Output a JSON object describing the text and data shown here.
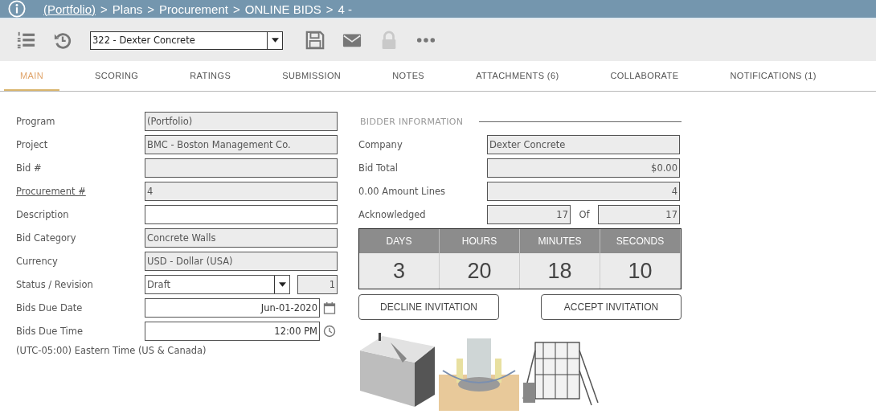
{
  "breadcrumb": {
    "separator": ">",
    "items": [
      {
        "text": "(Portfolio)",
        "link": true
      },
      {
        "text": "Plans",
        "link": false
      },
      {
        "text": "Procurement",
        "link": false
      },
      {
        "text": "ONLINE BIDS",
        "link": false
      },
      {
        "text": "4 -",
        "link": false
      }
    ]
  },
  "toolbar": {
    "record": "322 - Dexter Concrete",
    "icons": [
      {
        "kind": "list",
        "disabled": false
      },
      {
        "kind": "history",
        "disabled": false
      },
      {
        "kind": "select",
        "disabled": false
      },
      {
        "kind": "save",
        "disabled": false
      },
      {
        "kind": "mail",
        "disabled": false
      },
      {
        "kind": "lock",
        "disabled": true
      },
      {
        "kind": "more",
        "disabled": false
      }
    ]
  },
  "tabs": [
    {
      "label": "MAIN",
      "selected": true
    },
    {
      "label": "SCORING",
      "selected": false
    },
    {
      "label": "RATINGS",
      "selected": false
    },
    {
      "label": "SUBMISSION",
      "selected": false
    },
    {
      "label": "NOTES",
      "selected": false
    },
    {
      "label": "ATTACHMENTS (6)",
      "selected": false
    },
    {
      "label": "COLLABORATE",
      "selected": false
    },
    {
      "label": "NOTIFICATIONS (1)",
      "selected": false
    }
  ],
  "general": {
    "fields": [
      {
        "label": "Program",
        "kind": "readonly",
        "link": false,
        "value": "(Portfolio)"
      },
      {
        "label": "Project",
        "kind": "readonly",
        "link": false,
        "value": "BMC - Boston Management Co."
      },
      {
        "label": "Bid #",
        "kind": "readonly",
        "link": false
      },
      {
        "label": "Procurement #",
        "kind": "readonly",
        "link": true,
        "value": "4"
      },
      {
        "label": "Description",
        "kind": "input",
        "link": false
      },
      {
        "label": "Bid Category",
        "kind": "readonly",
        "link": false,
        "value": "Concrete Walls"
      },
      {
        "label": "Currency",
        "kind": "readonly",
        "link": false,
        "value": "USD - Dollar (USA)"
      },
      {
        "label": "Status / Revision",
        "kind": "select",
        "link": false,
        "value": "Draft",
        "revision": "1"
      },
      {
        "label": "Bids Due Date",
        "kind": "date",
        "link": false,
        "value": "Jun-01-2020"
      },
      {
        "label": "Bids Due Time",
        "kind": "time",
        "link": false,
        "value": "12:00 PM"
      }
    ],
    "timezone": "(UTC-05:00) Eastern Time (US & Canada)"
  },
  "bidder": {
    "title": "BIDDER INFORMATION",
    "fields": [
      {
        "label": "Company",
        "kind": "text",
        "value": "Dexter Concrete"
      },
      {
        "label": "Bid Total",
        "kind": "number",
        "value": "$0.00"
      },
      {
        "label": "0.00 Amount Lines",
        "kind": "number",
        "value": "4"
      },
      {
        "label": "Acknowledged",
        "kind": "pair",
        "value": "17",
        "joiner": "Of",
        "total": "17"
      }
    ],
    "countdown": [
      {
        "label": "DAYS",
        "value": "3"
      },
      {
        "label": "HOURS",
        "value": "20"
      },
      {
        "label": "MINUTES",
        "value": "18"
      },
      {
        "label": "SECONDS",
        "value": "10"
      }
    ],
    "buttons": [
      "DECLINE INVITATION",
      "ACCEPT INVITATION"
    ],
    "pictures": [
      {
        "kind": "picture"
      },
      {
        "kind": "picture"
      },
      {
        "kind": "picture"
      }
    ]
  }
}
